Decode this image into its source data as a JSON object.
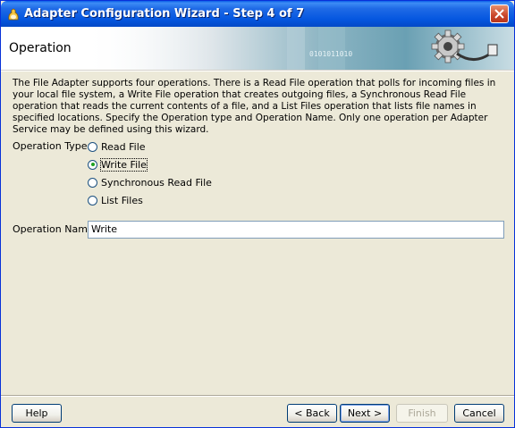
{
  "window": {
    "title": "Adapter Configuration Wizard - Step 4 of 7",
    "close_symbol": "close-icon"
  },
  "banner": {
    "title": "Operation",
    "graphic_icon": "gear-plug-icon"
  },
  "description": "The File Adapter supports four operations.  There is a Read File operation that polls for incoming files in your local file system, a Write File operation that creates outgoing files, a Synchronous Read File operation that reads the current contents of a file, and a List Files operation that lists file names in specified locations.  Specify the Operation type and Operation Name.  Only one operation per Adapter Service may be defined using this wizard.",
  "operation_type": {
    "label": "Operation Type:",
    "options": [
      {
        "label": "Read File",
        "selected": false
      },
      {
        "label": "Write File",
        "selected": true
      },
      {
        "label": "Synchronous Read File",
        "selected": false
      },
      {
        "label": "List Files",
        "selected": false
      }
    ]
  },
  "operation_name": {
    "label": "Operation Name:",
    "value": "Write"
  },
  "buttons": {
    "help": "Help",
    "back": "< Back",
    "next": "Next >",
    "finish": "Finish",
    "cancel": "Cancel"
  },
  "colors": {
    "titlebar": "#0557e0",
    "dialog_bg": "#ece9d8",
    "radio_dot": "#21a121"
  }
}
